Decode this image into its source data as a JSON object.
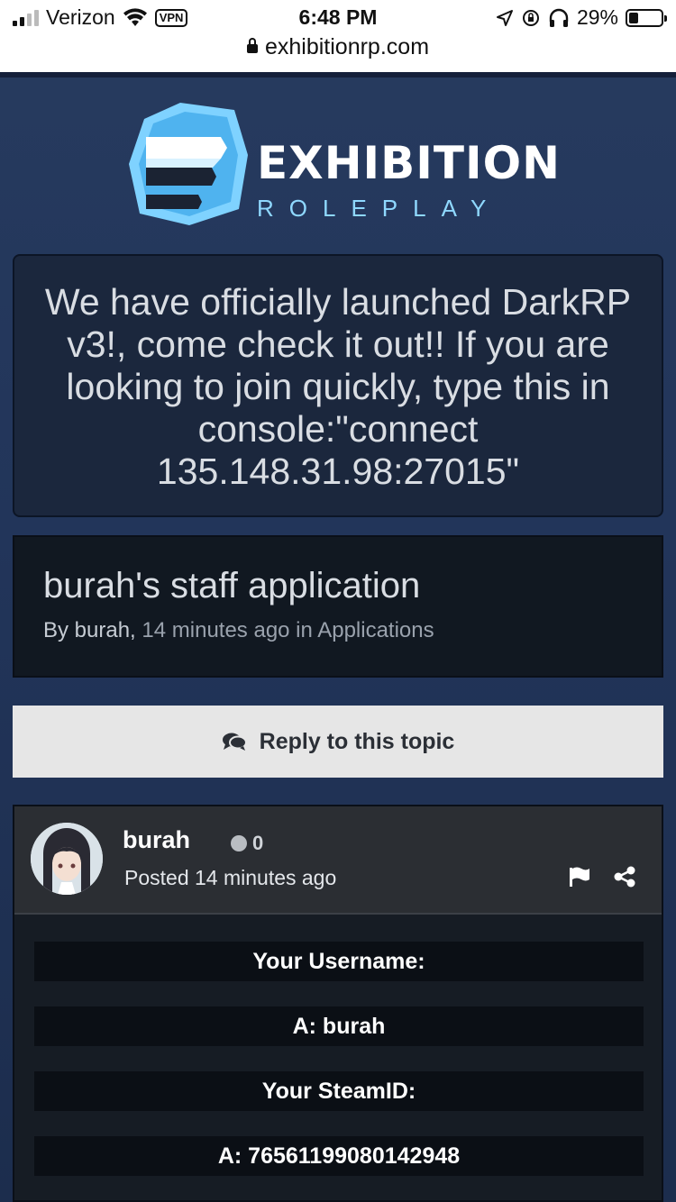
{
  "status_bar": {
    "carrier": "Verizon",
    "vpn": "VPN",
    "time": "6:48 PM",
    "battery": "29%",
    "battery_level": 0.29,
    "url": "exhibitionrp.com"
  },
  "logo": {
    "title": "EXHIBITION",
    "subtitle": "ROLEPLAY"
  },
  "announcement": {
    "text": "We have officially launched DarkRP v3!, come check it out!! If you are looking to join quickly, type this in console:\"connect 135.148.31.98:27015\""
  },
  "topic": {
    "title": "burah's staff application",
    "by_prefix": "By burah,",
    "meta_rest": "14 minutes ago in Applications"
  },
  "reply_button": {
    "label": "Reply to this topic"
  },
  "post": {
    "author": "burah",
    "reputation": "0",
    "posted": "Posted 14 minutes ago",
    "fields": [
      "Your Username:",
      "A: burah",
      "Your SteamID:",
      "A: 76561199080142948"
    ]
  },
  "colors": {
    "page_bg": "#22355a",
    "panel_dark": "#111821",
    "announce_bg": "#1b273d",
    "logo_accent": "#8fd8ff"
  }
}
